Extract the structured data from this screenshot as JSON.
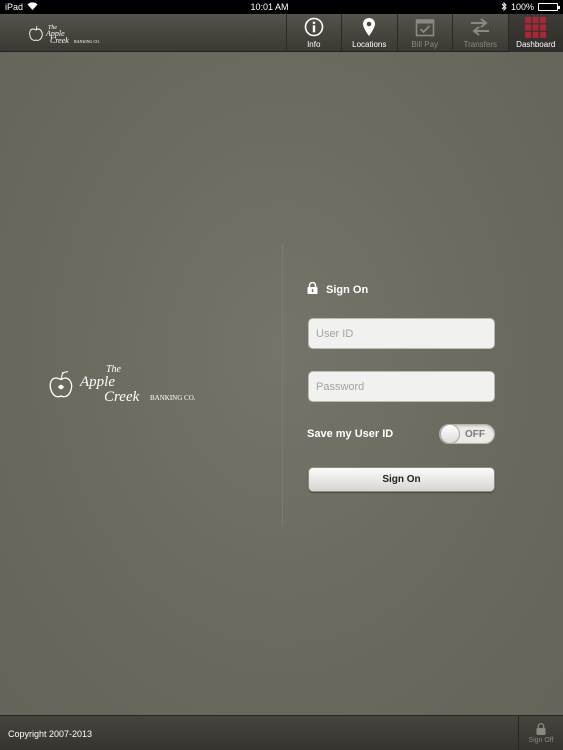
{
  "status_bar": {
    "device": "iPad",
    "time": "10:01 AM",
    "battery": "100%"
  },
  "nav": {
    "logo_icon": "apple-logo-icon",
    "items": [
      {
        "label": "Info",
        "icon": "info-icon",
        "state": "enabled"
      },
      {
        "label": "Locations",
        "icon": "location-pin-icon",
        "state": "enabled"
      },
      {
        "label": "Bill Pay",
        "icon": "calendar-check-icon",
        "state": "disabled"
      },
      {
        "label": "Transfers",
        "icon": "transfer-arrows-icon",
        "state": "disabled"
      },
      {
        "label": "Dashboard",
        "icon": "dashboard-grid-icon",
        "state": "active"
      }
    ]
  },
  "logo": {
    "line1": "The",
    "line2": "Apple",
    "line3": "Creek",
    "line4": "BANKING CO."
  },
  "signon": {
    "title": "Sign On",
    "user_id_placeholder": "User ID",
    "password_placeholder": "Password",
    "save_label": "Save my User ID",
    "toggle_state": "OFF",
    "button_label": "Sign On"
  },
  "footer": {
    "copyright": "Copyright 2007-2013",
    "signoff_label": "Sign Off"
  },
  "colors": {
    "background": "#6f6d60",
    "navbar": "#46453e",
    "dashboard_accent": "#b0243a"
  }
}
